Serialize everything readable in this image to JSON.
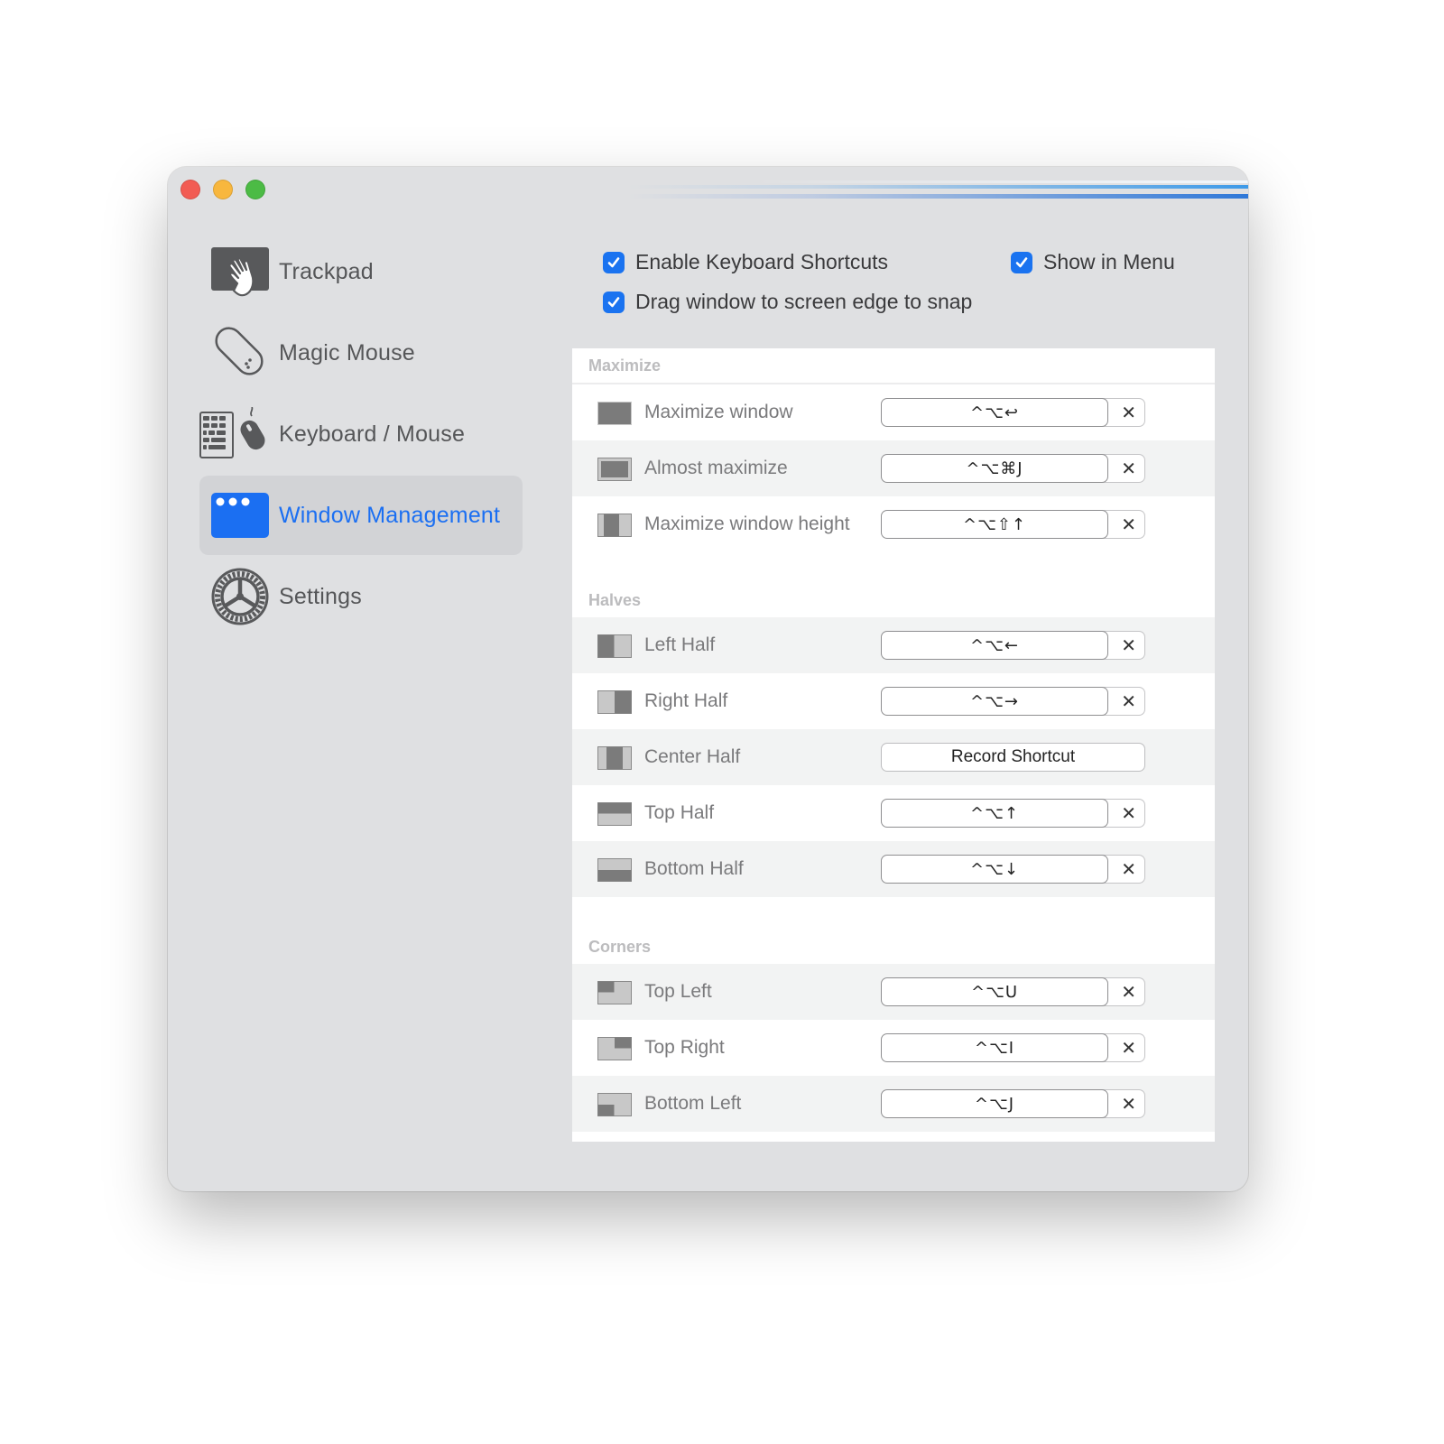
{
  "window": {
    "traffic_lights": [
      "close",
      "minimize",
      "zoom"
    ],
    "accent_color": "#1a73f0"
  },
  "sidebar": {
    "items": [
      {
        "label": "Trackpad",
        "icon": "trackpad-hand-icon",
        "active": false
      },
      {
        "label": "Magic Mouse",
        "icon": "magic-mouse-icon",
        "active": false
      },
      {
        "label": "Keyboard / Mouse",
        "icon": "keyboard-mouse-icon",
        "active": false
      },
      {
        "label": "Window Management",
        "icon": "window-icon",
        "active": true
      },
      {
        "label": "Settings",
        "icon": "gear-icon",
        "active": false
      }
    ]
  },
  "options": {
    "enable_shortcuts": {
      "label": "Enable Keyboard Shortcuts",
      "checked": true
    },
    "show_in_menu": {
      "label": "Show in Menu",
      "checked": true
    },
    "drag_to_snap": {
      "label": "Drag window to screen edge to snap",
      "checked": true
    }
  },
  "sections": [
    {
      "title": "Maximize",
      "rows": [
        {
          "name": "Maximize window",
          "icon": "maximize",
          "shortcut": "^⌥↩"
        },
        {
          "name": "Almost maximize",
          "icon": "almost-maximize",
          "shortcut": "^⌥⌘J"
        },
        {
          "name": "Maximize window height",
          "icon": "maximize-height",
          "shortcut": "^⌥⇧↑"
        }
      ]
    },
    {
      "title": "Halves",
      "rows": [
        {
          "name": "Left Half",
          "icon": "left-half",
          "shortcut": "^⌥←"
        },
        {
          "name": "Right Half",
          "icon": "right-half",
          "shortcut": "^⌥→"
        },
        {
          "name": "Center Half",
          "icon": "center-half",
          "shortcut": null,
          "record_label": "Record Shortcut"
        },
        {
          "name": "Top Half",
          "icon": "top-half",
          "shortcut": "^⌥↑"
        },
        {
          "name": "Bottom Half",
          "icon": "bottom-half",
          "shortcut": "^⌥↓"
        }
      ]
    },
    {
      "title": "Corners",
      "rows": [
        {
          "name": "Top Left",
          "icon": "top-left",
          "shortcut": "^⌥U"
        },
        {
          "name": "Top Right",
          "icon": "top-right",
          "shortcut": "^⌥I"
        },
        {
          "name": "Bottom Left",
          "icon": "bottom-left",
          "shortcut": "^⌥J"
        }
      ]
    }
  ],
  "clear_glyph": "✕"
}
